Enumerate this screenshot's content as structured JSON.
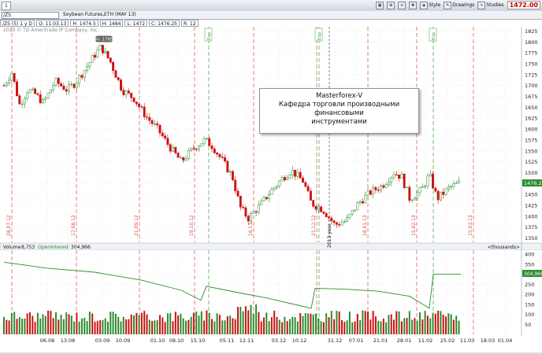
{
  "toolbar": {
    "chart_number": "1",
    "period_label": "1 y D",
    "quote_summary": "D: 11.03.13  H: 1484  L: 1472  C: 1476.25  R: 12",
    "style": "Style",
    "drawings": "Drawings",
    "studies": "Studies",
    "last_price": "1472.00"
  },
  "symbol": {
    "input_value": "/ZS",
    "description": "Soybean Futures,ETH (MAY 13)"
  },
  "header": {
    "study_label": "/ZS (5) 1 y D",
    "open": "O: 11.03.13",
    "h": "H: 1474.5",
    "l": "H: 1484",
    "c": "L: 1472",
    "last": "C: 1476.25",
    "r": "R: 12",
    "copyright": "2013 © TD Ameritrade IP Company, Inc."
  },
  "annotation": {
    "line1": "Masterforex-V",
    "line2": "Кафедра торговли производными финансовыми",
    "line3": "инструментами"
  },
  "price_badges": {
    "high_marker": "Hi: 1789",
    "current": "1476.25"
  },
  "volume_panel": {
    "volume_label": "Volume",
    "volume_value": "8,753",
    "oi_label": "OpenInterest",
    "oi_value": "304,966",
    "units": "<thousands>",
    "oi_badge": "304,966"
  },
  "colors": {
    "up": "#2e8b2e",
    "down": "#cc1111",
    "grid": "#d9dde3",
    "red_vline": "#d84a4a",
    "green_vline": "#3aa03a"
  },
  "chart_data": {
    "type": "candlestick",
    "price_axis": {
      "ticks": [
        "1825",
        "1800",
        "1775",
        "1750",
        "1725",
        "1700",
        "1675",
        "1650",
        "1625",
        "1600",
        "1575",
        "1550",
        "1525",
        "1500",
        "1475",
        "1450",
        "1425",
        "1400",
        "1375",
        "1350"
      ],
      "range": [
        1340,
        1835
      ]
    },
    "volume_axis": {
      "ticks": [
        "400",
        "350",
        "300",
        "250",
        "200",
        "150",
        "100",
        "50"
      ],
      "range": [
        0,
        420
      ]
    },
    "x_labels": [
      "06.08",
      "13.08",
      "03.09",
      "10.09",
      "01.10",
      "08.10",
      "15.10",
      "05.11",
      "12.11",
      "03.12",
      "10.12",
      "31.12",
      "07.01",
      "21.01",
      "28.01",
      "11.02",
      "25.02",
      "11.03",
      "18.03",
      "01.04"
    ],
    "red_vlines": [
      "28.07.12",
      "17.08.12",
      "21.09.12",
      "19.10.12",
      "16.11.12",
      "21.12.12",
      "18.01.13",
      "15.02.13",
      "15.03.13"
    ],
    "green_vlines": [
      "Exp",
      "Exp",
      "Exp"
    ],
    "year_marker": "2013 year",
    "high_label": "Hi: 1789",
    "current_price": "1476.25"
  }
}
